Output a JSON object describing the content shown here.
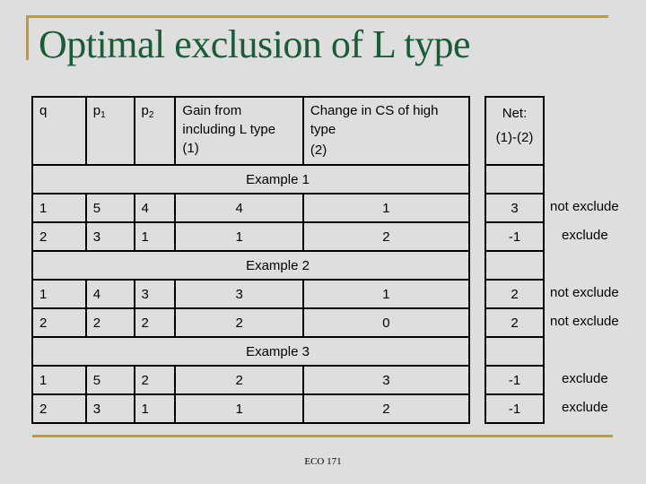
{
  "slide": {
    "title": "Optimal exclusion of L type",
    "footer": "ECO 171",
    "colors": {
      "title": "#1a5c36",
      "accent_gold": "#c49a35",
      "background": "#dedede"
    }
  },
  "table": {
    "headers": {
      "q": "q",
      "p1_base": "p",
      "p1_sub": "1",
      "p2_base": "p",
      "p2_sub": "2",
      "gain": [
        "Gain from",
        "including L type",
        "(1)"
      ],
      "change": [
        "Change in CS of high",
        "type",
        "(2)"
      ],
      "net": [
        "Net:",
        "(1)-(2)"
      ]
    },
    "examples": [
      {
        "label": "Example 1",
        "rows": [
          {
            "q": "1",
            "p1": "5",
            "p2": "4",
            "gain": "4",
            "change": "1",
            "net": "3",
            "decision": "not exclude"
          },
          {
            "q": "2",
            "p1": "3",
            "p2": "1",
            "gain": "1",
            "change": "2",
            "net": "-1",
            "decision": "exclude"
          }
        ]
      },
      {
        "label": "Example 2",
        "rows": [
          {
            "q": "1",
            "p1": "4",
            "p2": "3",
            "gain": "3",
            "change": "1",
            "net": "2",
            "decision": "not exclude"
          },
          {
            "q": "2",
            "p1": "2",
            "p2": "2",
            "gain": "2",
            "change": "0",
            "net": "2",
            "decision": "not exclude"
          }
        ]
      },
      {
        "label": "Example 3",
        "rows": [
          {
            "q": "1",
            "p1": "5",
            "p2": "2",
            "gain": "2",
            "change": "3",
            "net": "-1",
            "decision": "exclude"
          },
          {
            "q": "2",
            "p1": "3",
            "p2": "1",
            "gain": "1",
            "change": "2",
            "net": "-1",
            "decision": "exclude"
          }
        ]
      }
    ]
  }
}
